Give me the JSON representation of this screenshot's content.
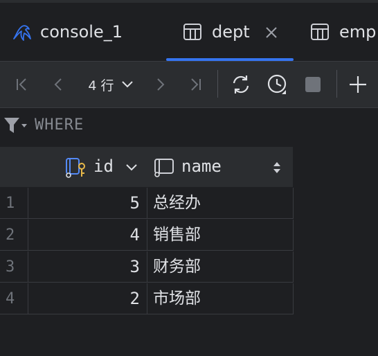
{
  "tabs": [
    {
      "label": "console_1",
      "icon": "mysql-dolphin-icon",
      "active": false
    },
    {
      "label": "dept",
      "icon": "table-icon",
      "active": true
    },
    {
      "label": "emp",
      "icon": "table-icon",
      "active": false
    }
  ],
  "toolbar": {
    "rows_label": "4 行"
  },
  "filter": {
    "label": "WHERE"
  },
  "columns": [
    {
      "label": "id",
      "icon": "primary-key-column-icon"
    },
    {
      "label": "name",
      "icon": "column-icon"
    }
  ],
  "rows": [
    {
      "num": "1",
      "id": "5",
      "name": "总经办"
    },
    {
      "num": "2",
      "id": "4",
      "name": "销售部"
    },
    {
      "num": "3",
      "id": "3",
      "name": "财务部"
    },
    {
      "num": "4",
      "id": "2",
      "name": "市场部"
    }
  ],
  "colors": {
    "accent": "#3574f0",
    "background": "#1e1f22",
    "toolbar": "#2b2d30",
    "key_icon": "#e8b94a"
  }
}
